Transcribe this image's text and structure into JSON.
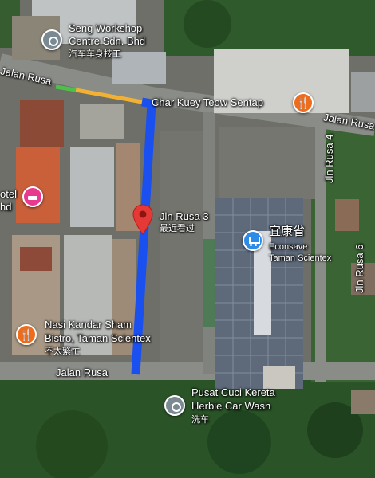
{
  "roads": {
    "jalan_rusa_top": "Jalan Rusa",
    "jalan_rusa_right": "Jalan Rusa",
    "jalan_rusa_bottom": "Jalan Rusa",
    "jln_rusa_4": "Jln Rusa 4",
    "jln_rusa_6": "Jln Rusa 6"
  },
  "pois": {
    "seng_workshop": {
      "name_line1": "Seng Workshop",
      "name_line2": "Centre Sdn. Bhd",
      "sub": "汽车车身技工",
      "icon": "location-pin-icon"
    },
    "char_kuey_teow": {
      "name": "Char Kuey Teow Sentap",
      "icon": "restaurant-icon"
    },
    "hotel": {
      "name_line1": "otel",
      "name_line2": "hd",
      "icon": "hotel-bed-icon"
    },
    "jln_rusa_3": {
      "name": "Jln Rusa 3",
      "sub": "最近看过",
      "icon": "red-map-pin-icon"
    },
    "econsave": {
      "name": "宜康省",
      "sub_line1": "Econsave",
      "sub_line2": "Taman Scientex",
      "icon": "shopping-cart-icon"
    },
    "nasi_kandar": {
      "name_line1": "Nasi Kandar Sham",
      "name_line2": "Bistro, Taman Scientex",
      "sub": "不太繁忙",
      "icon": "restaurant-icon"
    },
    "car_wash": {
      "name_line1": "Pusat Cuci Kereta",
      "name_line2": "Herbie Car Wash",
      "sub": "洗车",
      "icon": "location-pin-icon"
    }
  },
  "colors": {
    "route": "#1a4ff0",
    "route_yellow": "#f2b134",
    "route_green": "#4cc04a",
    "marker_red": "#e53935",
    "vegetation": "#2f5a2c",
    "road": "#7d7f7c"
  }
}
